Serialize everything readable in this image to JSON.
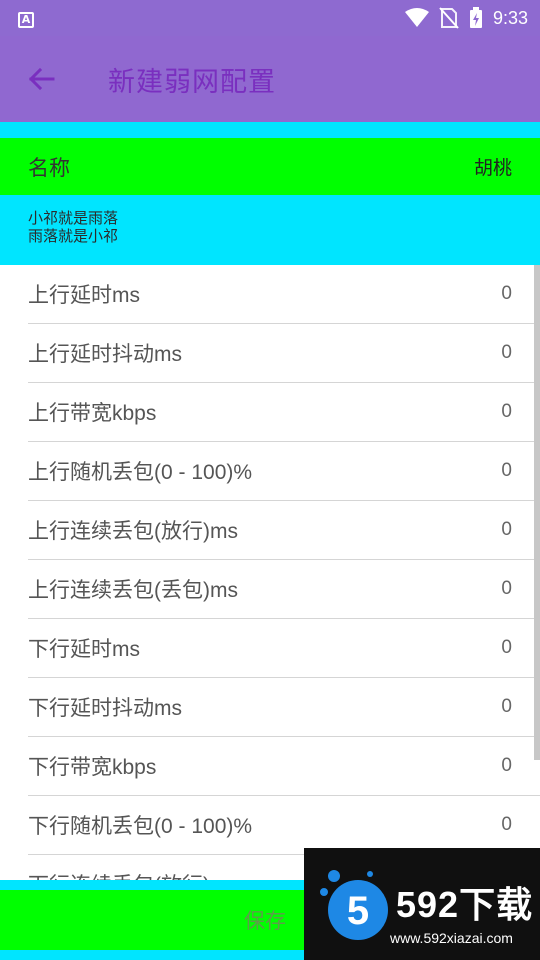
{
  "status_bar": {
    "left_icon": "A",
    "icons": [
      "wifi-icon",
      "no-sim-icon",
      "battery-charging-icon"
    ],
    "time": "9:33"
  },
  "appbar": {
    "title": "新建弱网配置",
    "back_icon": "arrow-left-icon"
  },
  "name_field": {
    "label": "名称",
    "value": "胡桃"
  },
  "description": {
    "line1": "小祁就是雨落",
    "line2": "雨落就是小祁"
  },
  "settings": [
    {
      "label": "上行延时ms",
      "value": "0"
    },
    {
      "label": "上行延时抖动ms",
      "value": "0"
    },
    {
      "label": "上行带宽kbps",
      "value": "0"
    },
    {
      "label": "上行随机丢包(0 - 100)%",
      "value": "0"
    },
    {
      "label": "上行连续丢包(放行)ms",
      "value": "0"
    },
    {
      "label": "上行连续丢包(丢包)ms",
      "value": "0"
    },
    {
      "label": "下行延时ms",
      "value": "0"
    },
    {
      "label": "下行延时抖动ms",
      "value": "0"
    },
    {
      "label": "下行带宽kbps",
      "value": "0"
    },
    {
      "label": "下行随机丢包(0 - 100)%",
      "value": "0"
    },
    {
      "label": "下行连续丢包(放行)",
      "value": ""
    }
  ],
  "save_button": {
    "label": "保存"
  },
  "watermark": {
    "brand": "592下载",
    "url": "www.592xiazai.com"
  },
  "colors": {
    "status_bar": "#8e6ad0",
    "appbar": "#9068d0",
    "title": "#7a2fbf",
    "green": "#00ff00",
    "cyan": "#00e5ff"
  }
}
